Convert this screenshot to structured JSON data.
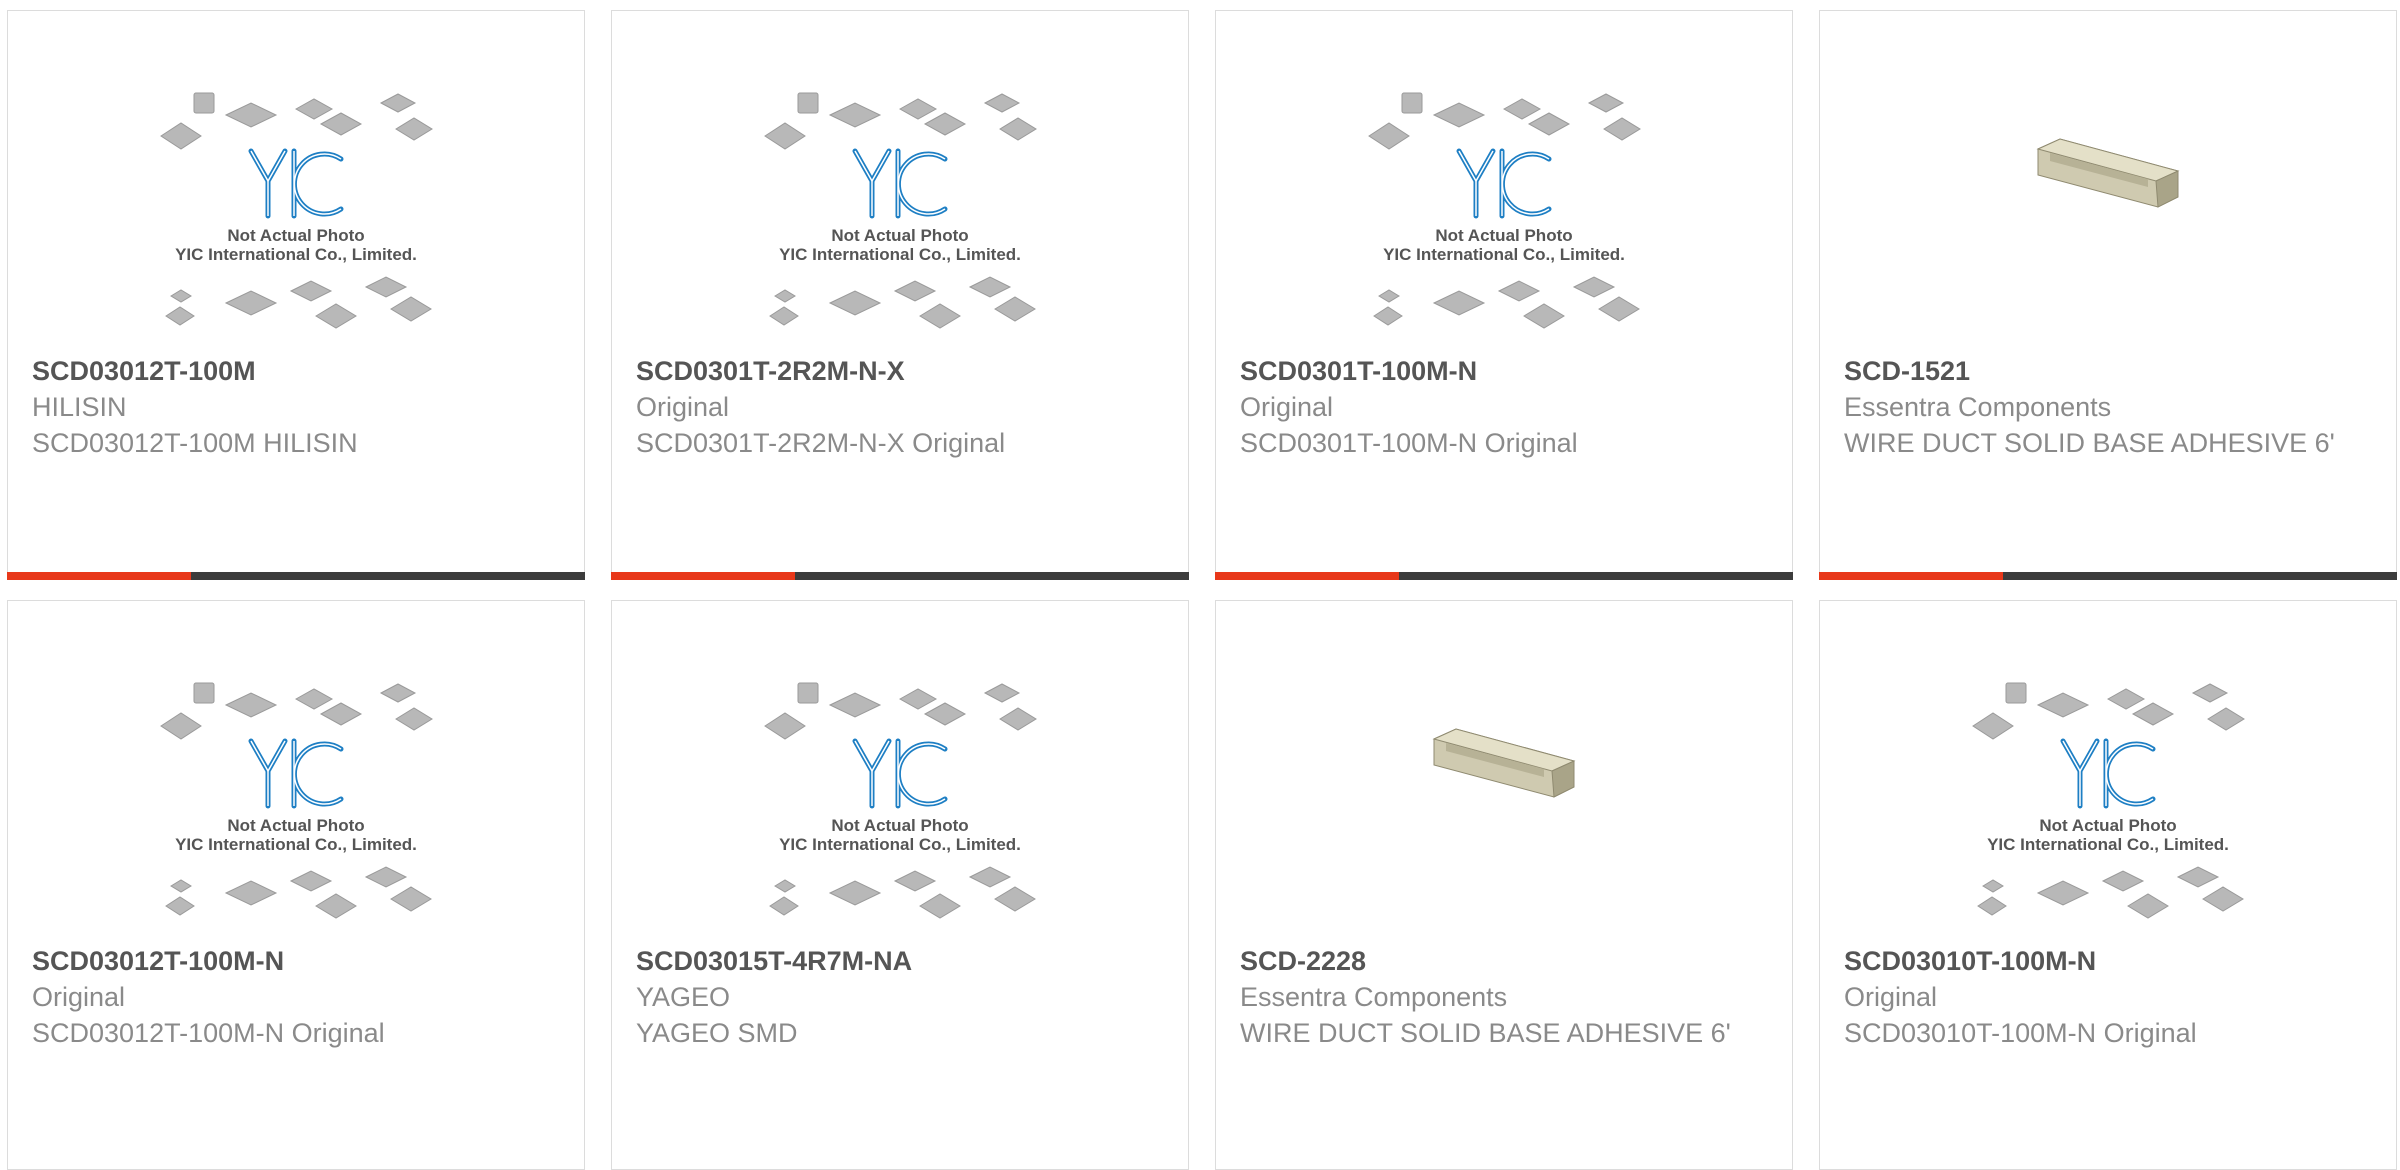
{
  "placeholder": {
    "brand": "YIC",
    "caption_line1": "Not Actual Photo",
    "caption_line2": "YIC International Co., Limited."
  },
  "colors": {
    "accent": "#e8381a",
    "bar": "#3c3c3c",
    "brand_blue": "#1e7fc4"
  },
  "products": [
    {
      "part": "SCD03012T-100M",
      "brand": "HILISIN",
      "description": "SCD03012T-100M HILISIN",
      "image": "placeholder-photo"
    },
    {
      "part": "SCD0301T-2R2M-N-X",
      "brand": "Original",
      "description": "SCD0301T-2R2M-N-X Original",
      "image": "placeholder-photo"
    },
    {
      "part": "SCD0301T-100M-N",
      "brand": "Original",
      "description": "SCD0301T-100M-N Original",
      "image": "placeholder-photo"
    },
    {
      "part": "SCD-1521",
      "brand": "Essentra Components",
      "description": "WIRE DUCT SOLID BASE ADHESIVE 6'",
      "image": "wire-duct-photo"
    },
    {
      "part": "SCD03012T-100M-N",
      "brand": "Original",
      "description": "SCD03012T-100M-N Original",
      "image": "placeholder-photo"
    },
    {
      "part": "SCD03015T-4R7M-NA",
      "brand": "YAGEO",
      "description": "YAGEO SMD",
      "image": "placeholder-photo"
    },
    {
      "part": "SCD-2228",
      "brand": "Essentra Components",
      "description": "WIRE DUCT SOLID BASE ADHESIVE 6'",
      "image": "wire-duct-photo"
    },
    {
      "part": "SCD03010T-100M-N",
      "brand": "Original",
      "description": "SCD03010T-100M-N Original",
      "image": "placeholder-photo"
    }
  ]
}
